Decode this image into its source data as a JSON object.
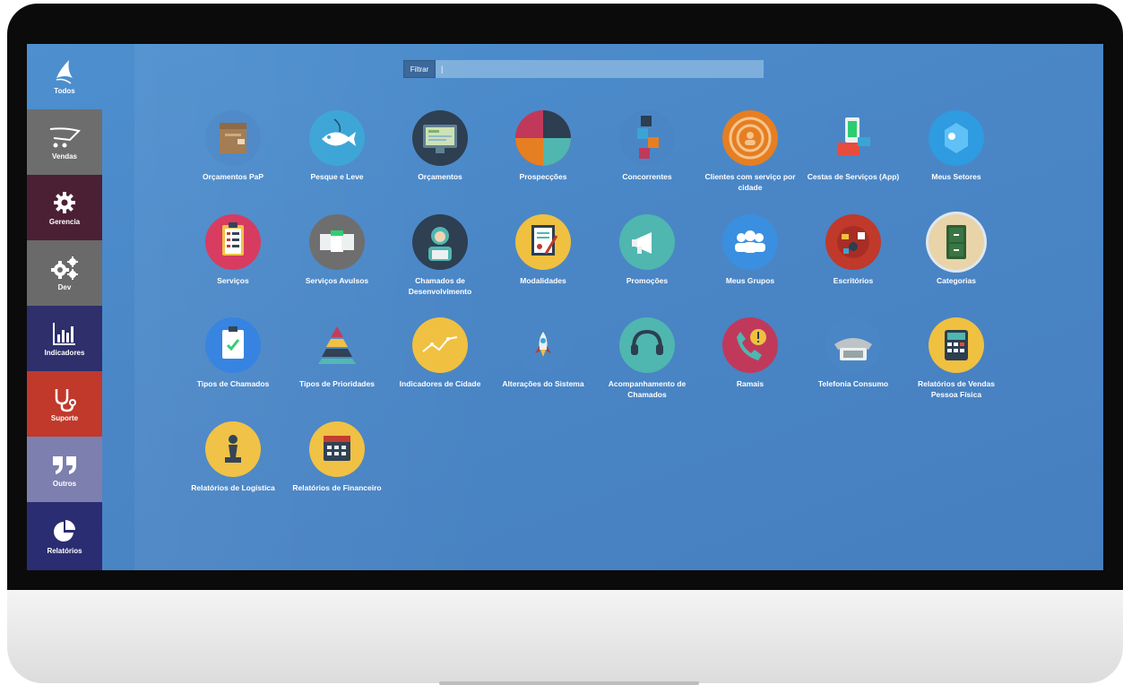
{
  "sidebar": [
    {
      "label": "Todos",
      "icon": "logo-icon",
      "color": "#4f8fd0"
    },
    {
      "label": "Vendas",
      "icon": "cart-icon",
      "color": "#6d6d6d"
    },
    {
      "label": "Gerencia",
      "icon": "gear-icon",
      "color": "#4b2035"
    },
    {
      "label": "Dev",
      "icon": "gears-icon",
      "color": "#6a6a6a"
    },
    {
      "label": "Indicadores",
      "icon": "bar-chart-icon",
      "color": "#2e2f6b"
    },
    {
      "label": "Suporte",
      "icon": "stethoscope-icon",
      "color": "#c0392b"
    },
    {
      "label": "Outros",
      "icon": "quote-icon",
      "color": "#7d7fae"
    },
    {
      "label": "Relatórios",
      "icon": "pie-chart-icon",
      "color": "#2b2d72"
    }
  ],
  "filter": {
    "button_label": "Filtrar",
    "value": "|"
  },
  "apps": [
    {
      "label": "Orçamentos PaP",
      "icon": "box-icon",
      "color": "#4a86c6"
    },
    {
      "label": "Pesque e Leve",
      "icon": "fish-icon",
      "color": "#3aa4d6"
    },
    {
      "label": "Orçamentos",
      "icon": "monitor-icon",
      "color": "#2c3e50"
    },
    {
      "label": "Prospecções",
      "icon": "pie-quad-icon",
      "color": "#c0395b"
    },
    {
      "label": "Concorrentes",
      "icon": "blocks-icon",
      "color": "#4a86c6"
    },
    {
      "label": "Clientes com serviço por cidade",
      "icon": "customers-circle-icon",
      "color": "#e67e22"
    },
    {
      "label": "Cestas de Serviços (App)",
      "icon": "phone-cart-icon",
      "color": "#4a86c6"
    },
    {
      "label": "Meus Setores",
      "icon": "sectors-icon",
      "color": "#2f9be0"
    },
    {
      "label": "Serviços",
      "icon": "clipboard-icon",
      "color": "#d6345a"
    },
    {
      "label": "Serviços Avulsos",
      "icon": "squares-icon",
      "color": "#6b6b6b"
    },
    {
      "label": "Chamados de Desenvolvimento",
      "icon": "developer-icon",
      "color": "#2c3e50"
    },
    {
      "label": "Modalidades",
      "icon": "document-pen-icon",
      "color": "#f0c040"
    },
    {
      "label": "Promoções",
      "icon": "megaphone-icon",
      "color": "#4fb6b0"
    },
    {
      "label": "Meus Grupos",
      "icon": "group-icon",
      "color": "#3a8fe0"
    },
    {
      "label": "Escritórios",
      "icon": "office-icon",
      "color": "#c0392b"
    },
    {
      "label": "Categorias",
      "icon": "cabinet-icon",
      "color": "#e8d4a8"
    },
    {
      "label": "Tipos de Chamados",
      "icon": "checklist-icon",
      "color": "#2f7fe0"
    },
    {
      "label": "Tipos de Prioridades",
      "icon": "pyramid-icon",
      "color": "#4a86c6"
    },
    {
      "label": "Indicadores de Cidade",
      "icon": "line-chart-icon",
      "color": "#f0c040"
    },
    {
      "label": "Alterações do Sistema",
      "icon": "rocket-icon",
      "color": "#4a86c6"
    },
    {
      "label": "Acompanhamento de Chamados",
      "icon": "headset-icon",
      "color": "#4fb6b0"
    },
    {
      "label": "Ramais",
      "icon": "phone-alert-icon",
      "color": "#c0395b"
    },
    {
      "label": "Telefonia Consumo",
      "icon": "telephone-icon",
      "color": "#4a86c6"
    },
    {
      "label": "Relatórios de Vendas Pessoa Física",
      "icon": "calculator-icon",
      "color": "#f0c040"
    },
    {
      "label": "Relatórios de Logística",
      "icon": "chess-pawn-icon",
      "color": "#f0c040"
    },
    {
      "label": "Relatórios de Financeiro",
      "icon": "calendar-icon",
      "color": "#f0c040"
    }
  ]
}
